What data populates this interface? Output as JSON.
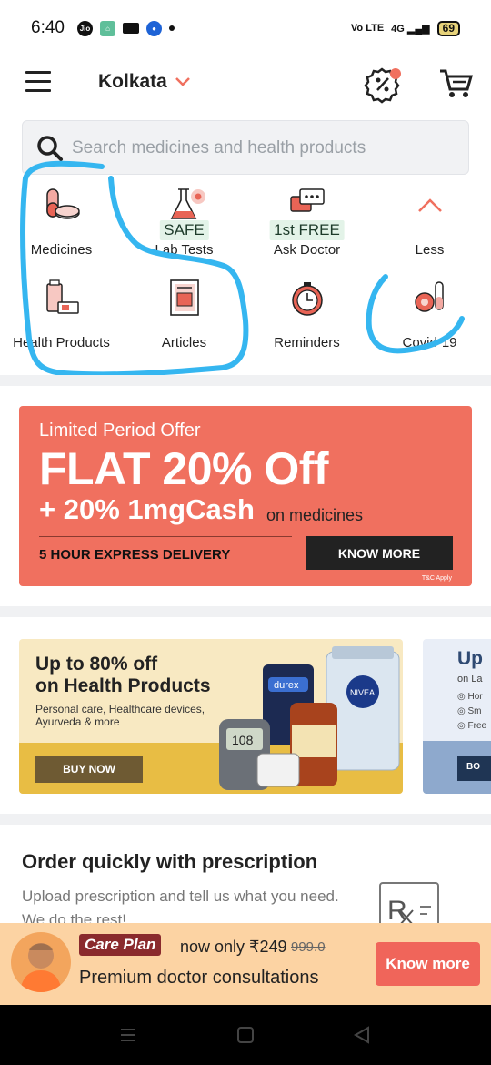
{
  "status_bar": {
    "time": "6:40",
    "network": "4G",
    "volte": "Vo LTE",
    "battery": "69"
  },
  "header": {
    "city": "Kolkata"
  },
  "search": {
    "placeholder": "Search medicines and health products"
  },
  "categories": [
    {
      "label": "Medicines",
      "icon": "pills-icon"
    },
    {
      "label": "Lab Tests",
      "tag": "SAFE",
      "icon": "lab-flask-icon"
    },
    {
      "label": "Ask Doctor",
      "tag": "1st FREE",
      "icon": "chat-icon"
    },
    {
      "label": "Less",
      "icon": "chevron-up-icon"
    },
    {
      "label": "Health Products",
      "icon": "health-products-icon"
    },
    {
      "label": "Articles",
      "icon": "article-icon"
    },
    {
      "label": "Reminders",
      "icon": "alarm-clock-icon"
    },
    {
      "label": "Covid-19",
      "icon": "covid-test-icon"
    }
  ],
  "offer_banner": {
    "line1": "Limited Period Offer",
    "line2": "FLAT 20% Off",
    "line3": "+ 20% 1mgCash",
    "line3_suffix": "on medicines",
    "delivery": "5 HOUR EXPRESS DELIVERY",
    "cta": "KNOW MORE",
    "terms": "T&C Apply"
  },
  "health_card": {
    "title_line1": "Up to 80% off",
    "title_line2": "on Health Products",
    "subtitle": "Personal care, Healthcare devices, Ayurveda & more",
    "cta": "BUY NOW",
    "product_text": "108"
  },
  "peek_card": {
    "title": "Up",
    "subtitle": "on La",
    "items": [
      "Hor",
      "Sm",
      "Free"
    ],
    "cta": "BO"
  },
  "order_section": {
    "title": "Order quickly with prescription",
    "subtitle": "Upload prescription and tell us what you need. We do the rest!"
  },
  "care_plan": {
    "tag": "Care Plan",
    "price_text": "now only ₹249",
    "old_price": "999.0",
    "description": "Premium doctor consultations",
    "cta": "Know more"
  },
  "colors": {
    "accent": "#f0705f",
    "scribble": "#35b6f0",
    "care_bg": "#fcd3a3"
  }
}
